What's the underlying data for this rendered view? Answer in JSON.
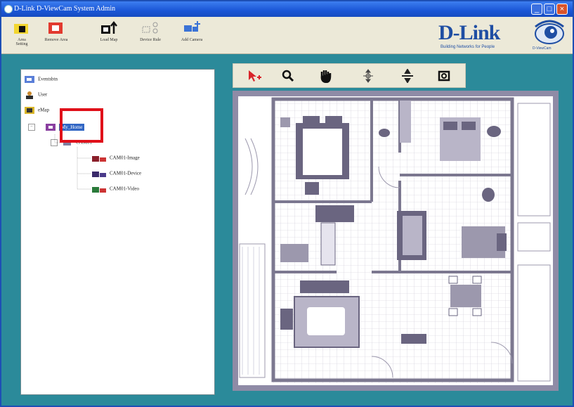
{
  "window": {
    "title": "D-Link D-ViewCam System Admin",
    "controls": {
      "minimize": "_",
      "maximize": "□",
      "close": "×"
    }
  },
  "toolbar": {
    "items": [
      {
        "label": "Area Setting",
        "icon": "area-setting-icon"
      },
      {
        "label": "Remove Area",
        "icon": "remove-area-icon"
      },
      {
        "label": "Load Map",
        "icon": "load-map-icon"
      },
      {
        "label": "Device Rule",
        "icon": "device-rule-icon"
      },
      {
        "label": "Add Camera",
        "icon": "add-camera-icon"
      }
    ]
  },
  "logo": {
    "brand": "D-Link",
    "tagline": "Building Networks for People",
    "sub": "D-ViewCam"
  },
  "tree": {
    "items": [
      {
        "label": "Eventsbtn",
        "icon": "event-icon"
      },
      {
        "label": "User",
        "icon": "user-icon"
      },
      {
        "label": "eMap",
        "icon": "emap-icon"
      },
      {
        "label": "My_Home",
        "icon": "area-icon",
        "selected": true
      },
      {
        "label": "CAM01",
        "icon": "camera-group-icon"
      },
      {
        "label": "CAM01-Image",
        "icon": "camera-icon"
      },
      {
        "label": "CAM01-Device",
        "icon": "camera-icon"
      },
      {
        "label": "CAM01-Video",
        "icon": "camera-icon"
      }
    ]
  },
  "map_toolbar": {
    "tools": [
      "select-add-icon",
      "zoom-icon",
      "pan-hand-icon",
      "move-vertical-icon",
      "move-horizontal-icon",
      "fit-view-icon"
    ]
  },
  "colors": {
    "background": "#2b8a9a",
    "titlebar": "#1a56d6",
    "highlight": "#e0101a",
    "map_frame": "#8f8ba6"
  }
}
